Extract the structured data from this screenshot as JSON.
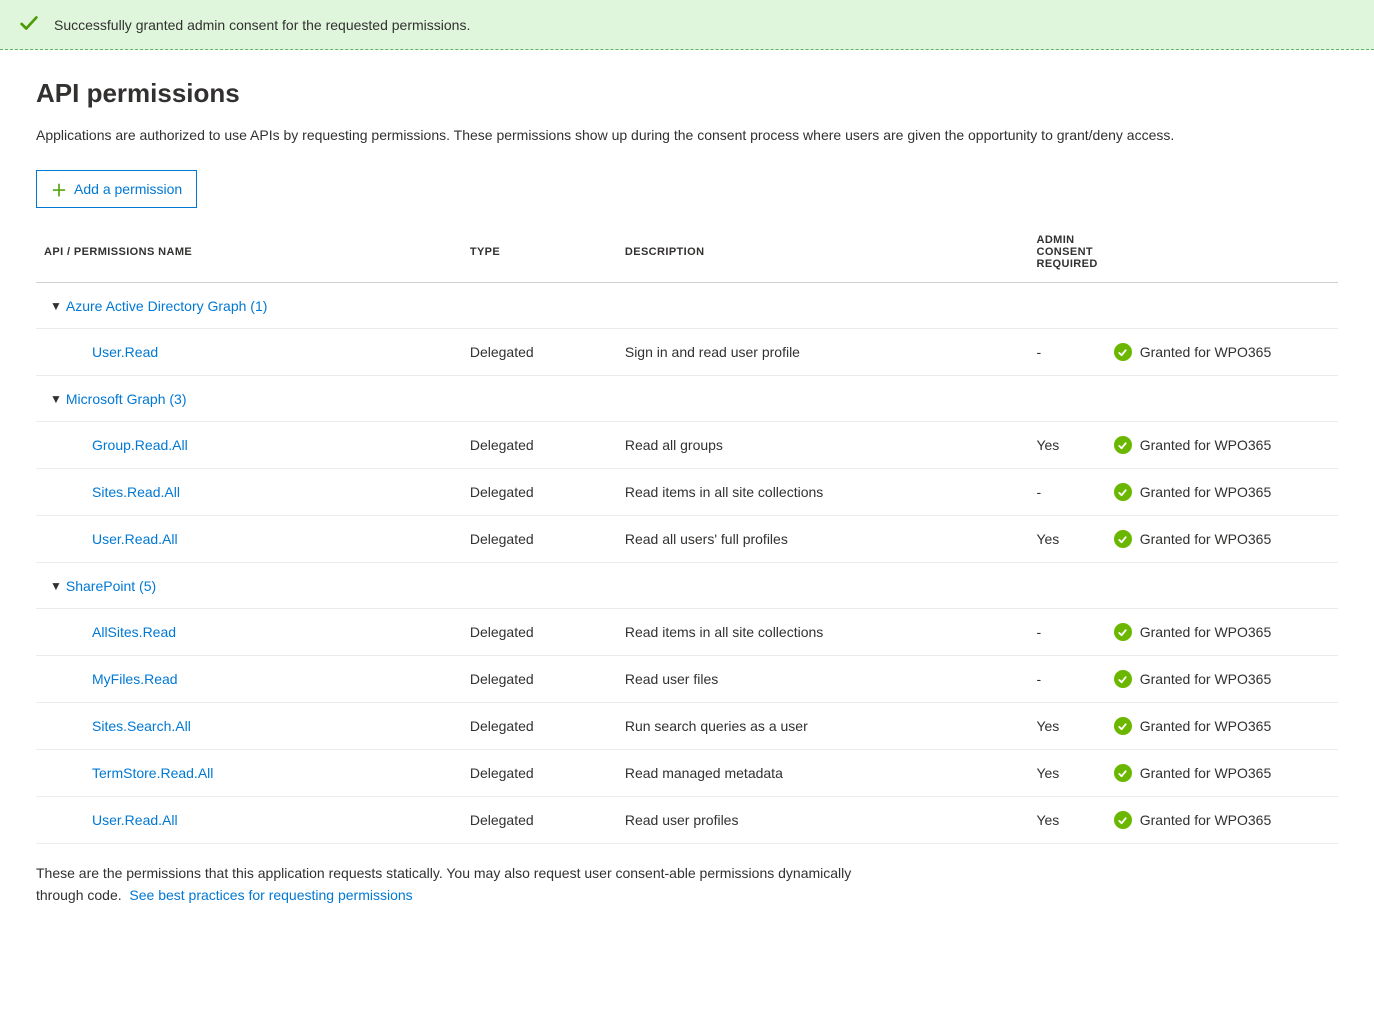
{
  "banner": {
    "message": "Successfully granted admin consent for the requested permissions."
  },
  "page": {
    "title": "API permissions",
    "description": "Applications are authorized to use APIs by requesting permissions. These permissions show up during the consent process where users are given the opportunity to grant/deny access.",
    "add_button": "Add a permission",
    "footer_text": "These are the permissions that this application requests statically. You may also request user consent-able permissions dynamically through code.",
    "footer_link": "See best practices for requesting permissions"
  },
  "table": {
    "headers": {
      "name": "API / PERMISSIONS NAME",
      "type": "TYPE",
      "description": "DESCRIPTION",
      "admin": "ADMIN CONSENT REQUIRED",
      "status": ""
    }
  },
  "granted_label": "Granted for WPO365",
  "apis": [
    {
      "name": "Azure Active Directory Graph (1)",
      "permissions": [
        {
          "name": "User.Read",
          "type": "Delegated",
          "description": "Sign in and read user profile",
          "admin": "-",
          "status": "Granted for WPO365"
        }
      ]
    },
    {
      "name": "Microsoft Graph (3)",
      "permissions": [
        {
          "name": "Group.Read.All",
          "type": "Delegated",
          "description": "Read all groups",
          "admin": "Yes",
          "status": "Granted for WPO365"
        },
        {
          "name": "Sites.Read.All",
          "type": "Delegated",
          "description": "Read items in all site collections",
          "admin": "-",
          "status": "Granted for WPO365"
        },
        {
          "name": "User.Read.All",
          "type": "Delegated",
          "description": "Read all users' full profiles",
          "admin": "Yes",
          "status": "Granted for WPO365"
        }
      ]
    },
    {
      "name": "SharePoint (5)",
      "permissions": [
        {
          "name": "AllSites.Read",
          "type": "Delegated",
          "description": "Read items in all site collections",
          "admin": "-",
          "status": "Granted for WPO365"
        },
        {
          "name": "MyFiles.Read",
          "type": "Delegated",
          "description": "Read user files",
          "admin": "-",
          "status": "Granted for WPO365"
        },
        {
          "name": "Sites.Search.All",
          "type": "Delegated",
          "description": "Run search queries as a user",
          "admin": "Yes",
          "status": "Granted for WPO365"
        },
        {
          "name": "TermStore.Read.All",
          "type": "Delegated",
          "description": "Read managed metadata",
          "admin": "Yes",
          "status": "Granted for WPO365"
        },
        {
          "name": "User.Read.All",
          "type": "Delegated",
          "description": "Read user profiles",
          "admin": "Yes",
          "status": "Granted for WPO365"
        }
      ]
    }
  ]
}
